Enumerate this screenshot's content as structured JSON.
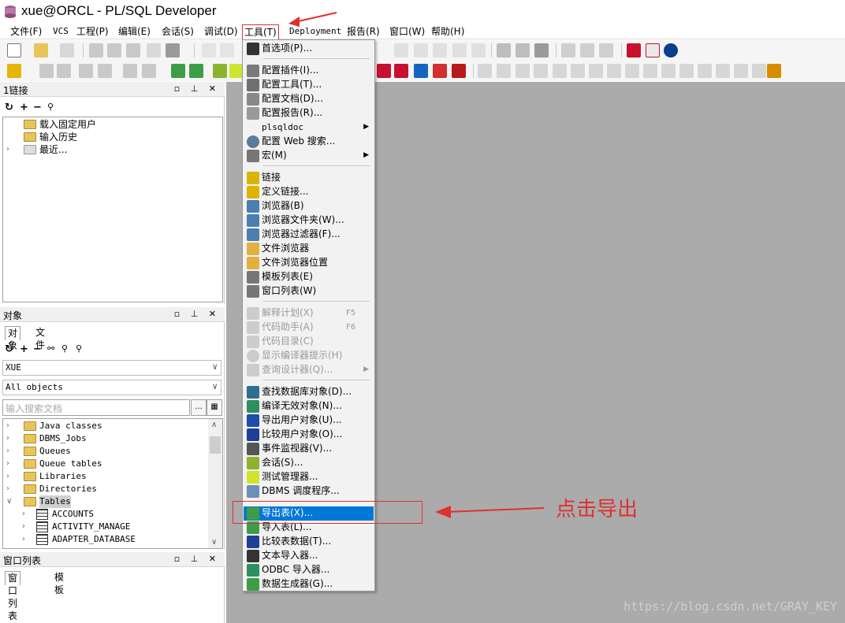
{
  "window": {
    "title": "xue@ORCL - PL/SQL Developer"
  },
  "menubar": {
    "items": [
      "文件(F)",
      "VCS",
      "工程(P)",
      "编辑(E)",
      "会话(S)",
      "调试(D)",
      "工具(T)",
      "Deployment",
      "报告(R)",
      "窗口(W)",
      "帮助(H)"
    ]
  },
  "connection_panel": {
    "title": "1链接",
    "tree": [
      "载入固定用户",
      "输入历史",
      "最近..."
    ]
  },
  "object_panel": {
    "title": "对象",
    "tabs": [
      "对象",
      "文件"
    ],
    "user_select": "XUE",
    "filter_select": "All objects",
    "search_placeholder": "输入搜索文档",
    "tree": [
      "Java classes",
      "DBMS_Jobs",
      "Queues",
      "Queue tables",
      "Libraries",
      "Directories",
      "Tables",
      "ACCOUNTS",
      "ACTIVITY_MANAGE",
      "ADAPTER_DATABASE"
    ]
  },
  "window_list_panel": {
    "title": "窗口列表",
    "tabs": [
      "窗口列表",
      "模板"
    ]
  },
  "tools_menu": {
    "items": [
      {
        "label": "首选项(P)..."
      },
      {
        "label": "配置插件(I)..."
      },
      {
        "label": "配置工具(T)..."
      },
      {
        "label": "配置文档(D)..."
      },
      {
        "label": "配置报告(R)..."
      },
      {
        "label": "plsqldoc"
      },
      {
        "label": "配置 Web 搜索..."
      },
      {
        "label": "宏(M)"
      },
      {
        "label": "链接"
      },
      {
        "label": "定义链接..."
      },
      {
        "label": "浏览器(B)"
      },
      {
        "label": "浏览器文件夹(W)..."
      },
      {
        "label": "浏览器过滤器(F)..."
      },
      {
        "label": "文件浏览器"
      },
      {
        "label": "文件浏览器位置"
      },
      {
        "label": "模板列表(E)"
      },
      {
        "label": "窗口列表(W)"
      },
      {
        "label": "解释计划(X)",
        "shortcut": "F5"
      },
      {
        "label": "代码助手(A)",
        "shortcut": "F6"
      },
      {
        "label": "代码目录(C)"
      },
      {
        "label": "显示编译器提示(H)"
      },
      {
        "label": "查询设计器(Q)..."
      },
      {
        "label": "查找数据库对象(D)..."
      },
      {
        "label": "编译无效对象(N)..."
      },
      {
        "label": "导出用户对象(U)..."
      },
      {
        "label": "比较用户对象(O)..."
      },
      {
        "label": "事件监视器(V)..."
      },
      {
        "label": "会话(S)..."
      },
      {
        "label": "测试管理器..."
      },
      {
        "label": "DBMS 调度程序..."
      },
      {
        "label": "导出表(X)..."
      },
      {
        "label": "导入表(L)..."
      },
      {
        "label": "比较表数据(T)..."
      },
      {
        "label": "文本导入器..."
      },
      {
        "label": "ODBC 导入器..."
      },
      {
        "label": "数据生成器(G)..."
      }
    ]
  },
  "annotation": {
    "text": "点击导出"
  },
  "watermark": "https://blog.csdn.net/GRAY_KEY",
  "colors": {
    "highlight": "#0078d7",
    "annotation": "#e03030",
    "workspace": "#ababab"
  }
}
